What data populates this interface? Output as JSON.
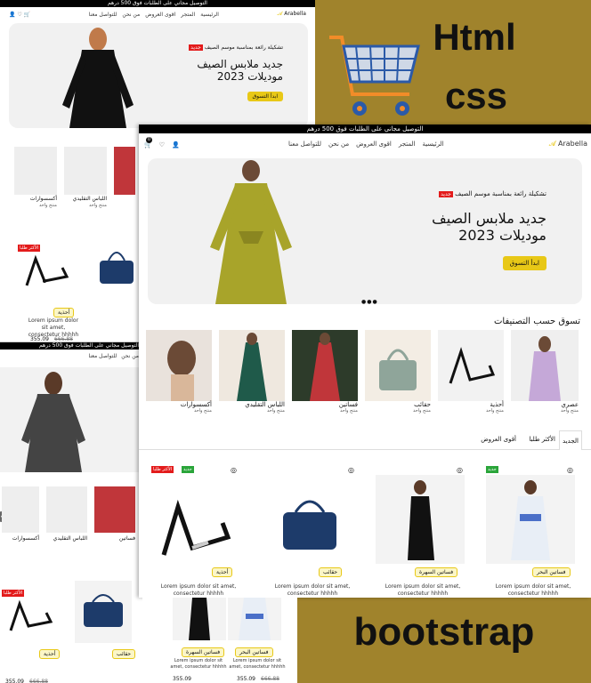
{
  "promo": {
    "line1": "Html",
    "line2": "css",
    "line3": "bootstrap"
  },
  "shop": {
    "topbar": "التوصيل مجاني على الطلبات فوق 500 درهم",
    "brand": "Arabella",
    "nav": [
      "الرئيسية",
      "المتجر",
      "اقوى العروض",
      "من نحن",
      "للتواصل معنا"
    ],
    "cart_count": "0",
    "hero": {
      "tag": "جديد",
      "tagline": "تشكيلة رائعة بمناسبة موسم الصيف",
      "title_line1": "جديد ملابس الصيف",
      "title_line2": "موديلات 2023",
      "button": "ابدأ التسوق"
    },
    "section_title": "تسوق حسب التصنيفات",
    "categories": [
      {
        "name": "عصري",
        "count": "منتج واحد"
      },
      {
        "name": "أحذية",
        "count": "منتج واحد"
      },
      {
        "name": "حقائب",
        "count": "منتج واحد"
      },
      {
        "name": "فساتين",
        "count": "منتج واحد"
      },
      {
        "name": "اللباس التقليدي",
        "count": "منتج واحد"
      },
      {
        "name": "أكسسوارات",
        "count": "منتج واحد"
      }
    ],
    "tabs": [
      "الجديد",
      "الأكثر طلبا",
      "أقوى العروض"
    ],
    "products": [
      {
        "badge": "جديد",
        "tag": "فساتين البحر",
        "desc": "Lorem ipsum dolor sit amet, consectetur hhhhh"
      },
      {
        "badge": "",
        "tag": "فساتين السهرة",
        "desc": "Lorem ipsum dolor sit amet, consectetur hhhhh"
      },
      {
        "badge": "",
        "tag": "حقائب",
        "desc": "Lorem ipsum dolor sit amet, consectetur hhhhh"
      },
      {
        "badge": "الأكثر طلبا",
        "badge2": "جديد",
        "tag": "أحذية",
        "desc": "Lorem ipsum dolor sit amet, consectetur hhhhh"
      }
    ],
    "price_now": "355.09",
    "price_old": "666.88",
    "small_lorem": "Lorem ipsum dolor sit amet, consectetur hhhhh"
  },
  "colors": {
    "gold": "#a0832c",
    "yellow": "#e8c817",
    "red": "#e31b1b",
    "green": "#2aa53a"
  }
}
